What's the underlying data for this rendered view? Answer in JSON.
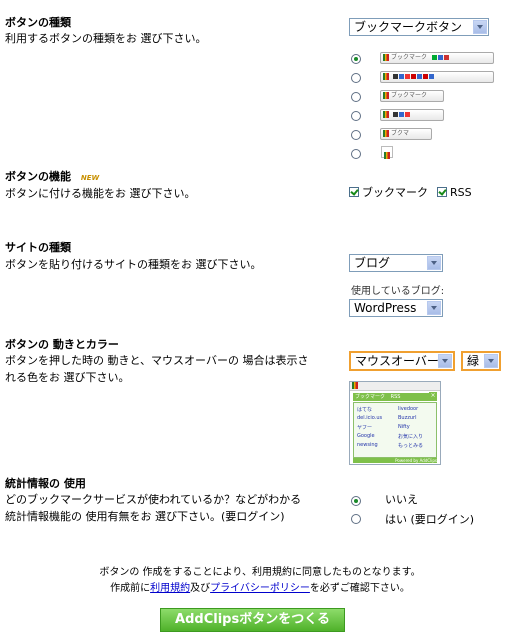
{
  "button_type": {
    "heading": "ボタンの種類",
    "description": "利用するボタンの種類をお 選び下さい。",
    "selected": "ブックマークボタン",
    "options": [
      {
        "label": "ブックマーク",
        "checked": true
      },
      {
        "label": "",
        "checked": false
      },
      {
        "label": "ブックマーク",
        "checked": false
      },
      {
        "label": "",
        "checked": false
      },
      {
        "label": "ブクマ",
        "checked": false
      },
      {
        "label": "",
        "checked": false
      }
    ]
  },
  "button_function": {
    "heading": "ボタンの機能",
    "new_badge": "NEW",
    "description": "ボタンに付ける機能をお 選び下さい。",
    "checkbox_bookmark": "ブックマーク",
    "checkbox_rss": "RSS"
  },
  "site_type": {
    "heading": "サイトの種類",
    "description": "ボタンを貼り付けるサイトの種類をお 選び下さい。",
    "selected": "ブログ",
    "blog_label": "使用しているブログ:",
    "blog_selected": "WordPress"
  },
  "motion_color": {
    "heading": "ボタンの 動きとカラー",
    "description_line1": "ボタンを押した時の 動きと、マウスオーバーの 場合は表示さ",
    "description_line2": "れる色をお 選び下さい。",
    "motion_selected": "マウスオーバー",
    "color_selected": "緑",
    "preview": {
      "tab": "ブックマーク",
      "tab2": "RSS",
      "items_left": [
        "はてな",
        "del.icio.us",
        "ヤフー",
        "Google",
        "newsing"
      ],
      "items_right": [
        "livedoor",
        "Buzzurl",
        "Nifty",
        "お気に入り",
        "もっとみる"
      ],
      "footer": "Powered by AddClips"
    }
  },
  "statistics": {
    "heading": "統計情報の 使用",
    "description_line1": "どのブックマークサービスが使われているか？などがわかる",
    "description_line2": "統計情報機能の 使用有無をお 選び下さい。(要ログイン)",
    "option_no": "いいえ",
    "option_yes": "はい (要ログイン)"
  },
  "footer": {
    "notice_line1": "ボタンの 作成をすることにより、利用規約に同意したものとなります。",
    "notice_pre": "作成前に",
    "terms_link": "利用規約",
    "notice_mid": "及び",
    "privacy_link": "プライバシーポリシー",
    "notice_post": "を必ずご確認下さい。",
    "submit_label": "AddClipsボタンをつくる"
  },
  "colors": {
    "accent_green": "#4fb12a",
    "link_blue": "#0000cc",
    "new_badge": "#c89000"
  }
}
